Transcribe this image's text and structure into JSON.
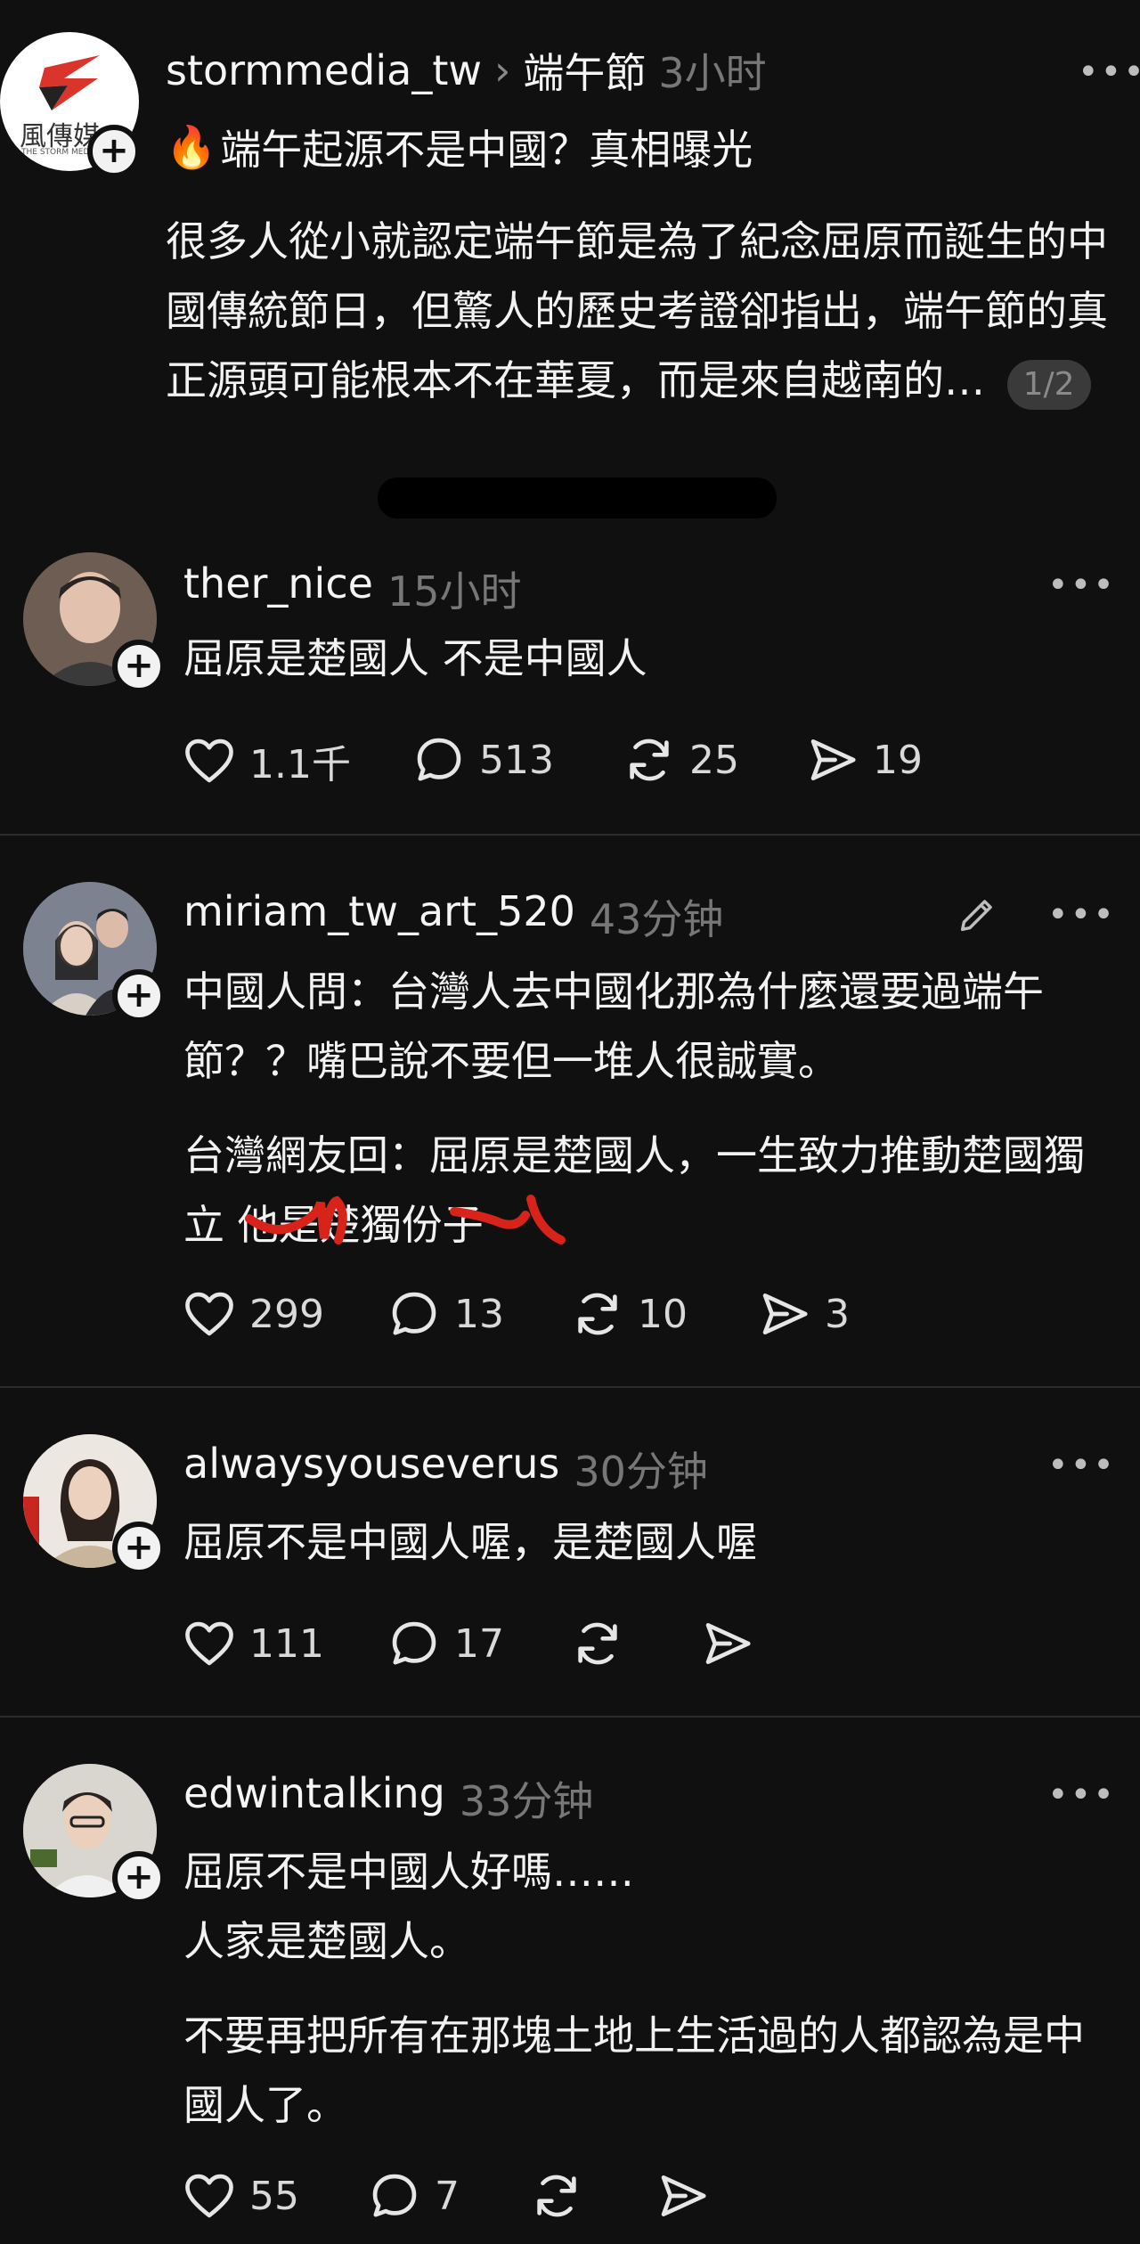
{
  "post": {
    "username": "stormmedia_tw",
    "separator": "›",
    "topic": "端午節",
    "time": "3小时",
    "title_emoji": "🔥",
    "title": "端午起源不是中國？真相曝光",
    "body": "很多人從小就認定端午節是為了紀念屈原而誕生的中國傳統節日，但驚人的歷史考證卻指出，端午節的真正源頭可能根本不在華夏，而是來自越南的…",
    "page_indicator": "1/2",
    "logo_text": "風傳媒",
    "logo_subtext": "THE STORM MEDIA"
  },
  "comments": [
    {
      "username": "ther_nice",
      "time": "15小时",
      "paragraphs": [
        "屈原是楚國人 不是中國人"
      ],
      "likes": "1.1千",
      "replies": "513",
      "reposts": "25",
      "shares": "19"
    },
    {
      "username": "miriam_tw_art_520",
      "time": "43分钟",
      "paragraphs": [
        "中國人問：台灣人去中國化那為什麼還要過端午節？？嘴巴說不要但一堆人很誠實。",
        "台灣網友回：屈原是楚國人，一生致力推動楚國獨立 他是楚獨份子"
      ],
      "likes": "299",
      "replies": "13",
      "reposts": "10",
      "shares": "3"
    },
    {
      "username": "alwaysyouseverus",
      "time": "30分钟",
      "paragraphs": [
        "屈原不是中國人喔，是楚國人喔"
      ],
      "likes": "111",
      "replies": "17",
      "reposts": "",
      "shares": ""
    },
    {
      "username": "edwintalking",
      "time": "33分钟",
      "paragraphs": [
        "屈原不是中國人好嗎……\n人家是楚國人。",
        "不要再把所有在那塊土地上生活過的人都認為是中國人了。"
      ],
      "likes": "55",
      "replies": "7",
      "reposts": "",
      "shares": ""
    }
  ],
  "ui": {
    "more_glyph": "•••",
    "follow_glyph": "+"
  }
}
